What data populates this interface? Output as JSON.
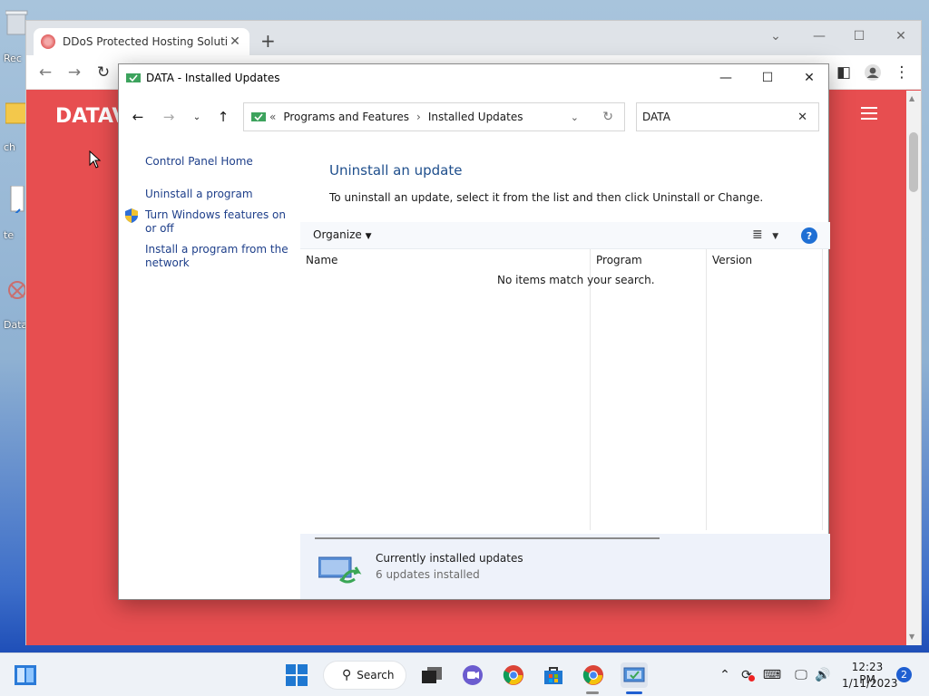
{
  "desktop": {
    "icons": [
      {
        "label": "Rec",
        "icon": "recycle-bin-icon"
      },
      {
        "label": "ch",
        "icon": "folder-icon"
      },
      {
        "label": "te",
        "icon": "shortcut-icon"
      },
      {
        "label": "Data",
        "icon": "datavix-shortcut-icon"
      }
    ]
  },
  "browser": {
    "tab_title": "DDoS Protected Hosting Solutio",
    "site_brand": "DATAV"
  },
  "cp": {
    "window_title": "DATA - Installed Updates",
    "breadcrumb": {
      "prefix": "«",
      "items": [
        "Programs and Features",
        "Installed Updates"
      ],
      "separator": "›"
    },
    "search_value": "DATA",
    "left_links": {
      "control_panel_home": "Control Panel Home",
      "uninstall_program": "Uninstall a program",
      "windows_features": "Turn Windows features on or off",
      "install_from_network": "Install a program from the network"
    },
    "heading": "Uninstall an update",
    "instructions": "To uninstall an update, select it from the list and then click Uninstall or Change.",
    "organize_label": "Organize",
    "columns": [
      "Name",
      "Program",
      "Version"
    ],
    "empty_message": "No items match your search.",
    "details": {
      "title": "Currently installed updates",
      "subtitle": "6 updates installed"
    }
  },
  "taskbar": {
    "search_label": "Search",
    "time": "12:23 PM",
    "date": "1/11/2023",
    "notification_count": "2"
  },
  "colors": {
    "accent": "#1f5fd1",
    "site_red": "#e74e50",
    "link_blue": "#1e3f8a"
  }
}
